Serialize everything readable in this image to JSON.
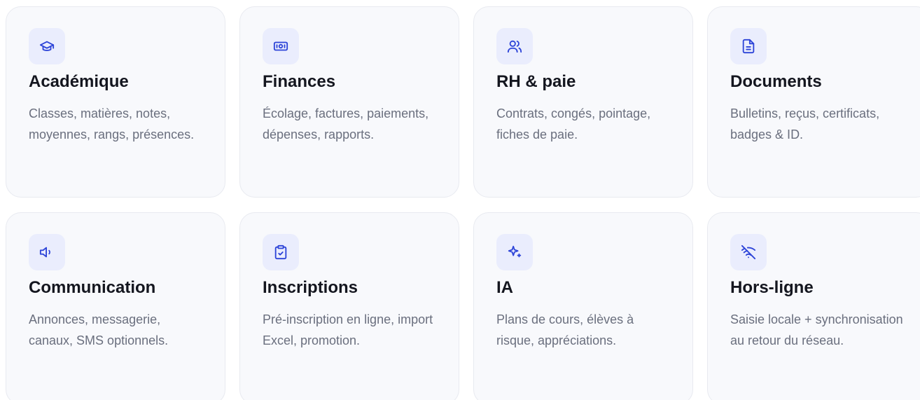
{
  "accent_color": "#2d44d8",
  "icon_bg_color": "#eaedfd",
  "card_bg_color": "#f8f9fc",
  "cards": [
    {
      "icon": "graduation-cap-icon",
      "title": "Académique",
      "description": "Classes, matières, notes, moyennes, rangs, présences."
    },
    {
      "icon": "banknote-icon",
      "title": "Finances",
      "description": "Écolage, factures, paiements, dépenses, rapports."
    },
    {
      "icon": "users-icon",
      "title": "RH & paie",
      "description": "Contrats, congés, pointage, fiches de paie."
    },
    {
      "icon": "file-text-icon",
      "title": "Documents",
      "description": "Bulletins, reçus, certificats, badges & ID."
    },
    {
      "icon": "megaphone-icon",
      "title": "Communication",
      "description": "Annonces, messagerie, canaux, SMS optionnels."
    },
    {
      "icon": "clipboard-check-icon",
      "title": "Inscriptions",
      "description": "Pré-inscription en ligne, import Excel, promotion."
    },
    {
      "icon": "sparkles-icon",
      "title": "IA",
      "description": "Plans de cours, élèves à risque, appréciations."
    },
    {
      "icon": "wifi-off-icon",
      "title": "Hors-ligne",
      "description": "Saisie locale + synchronisation au retour du réseau."
    }
  ]
}
